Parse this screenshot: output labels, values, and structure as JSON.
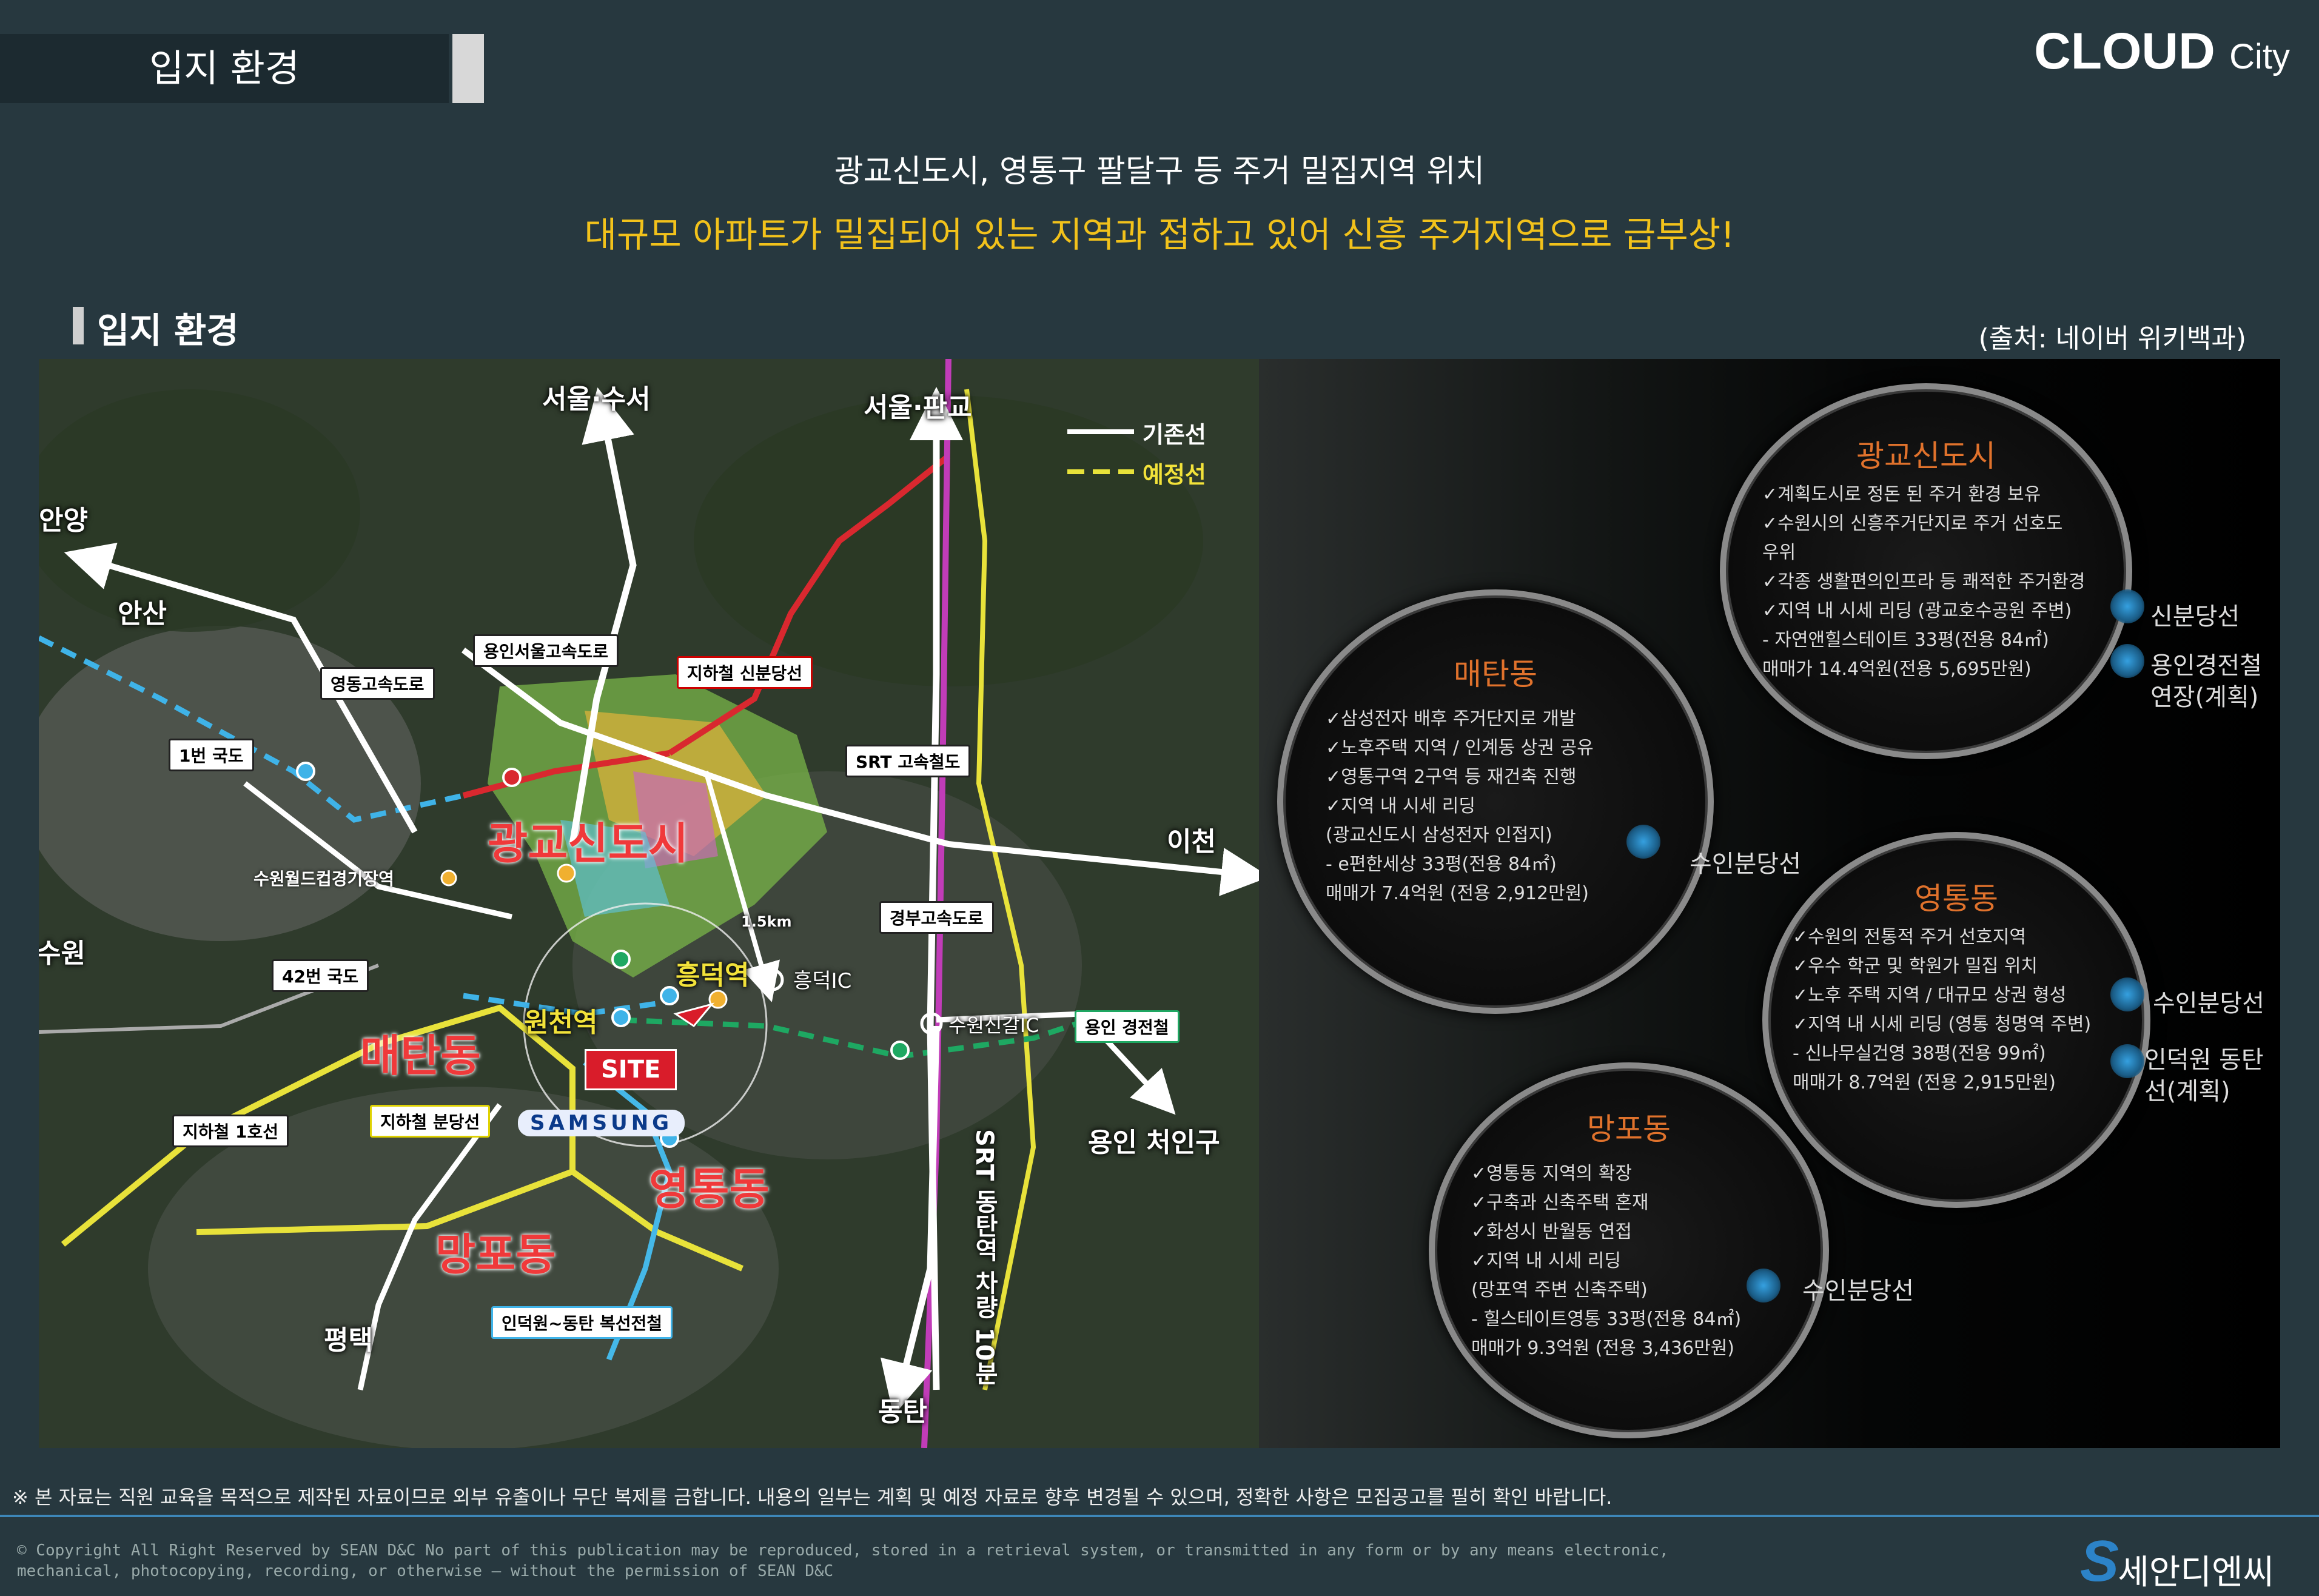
{
  "header": {
    "title": "입지 환경",
    "brand_main": "CLOUD",
    "brand_sub": "City"
  },
  "headline": {
    "line1": "광교신도시, 영통구 팔달구 등 주거 밀집지역 위치",
    "line2": "대규모 아파트가 밀집되어 있는 지역과 접하고 있어 신흥 주거지역으로 급부상!"
  },
  "section": {
    "title": "입지  환경",
    "source": "(출처: 네이버 위키백과)"
  },
  "map": {
    "legend": {
      "existing": "기존선",
      "planned": "예정선"
    },
    "places": {
      "seoul_suseo": "서울·수서",
      "seoul_pangyo": "서울·판교",
      "anyang": "안양",
      "ansan": "안산",
      "suwon": "수원",
      "icheon": "이천",
      "yongin": "용인 처인구",
      "pyeongtaek": "평택",
      "dongtan": "동탄",
      "heungdeok_ic": "흥덕IC",
      "suwon_sin_ic": "수원신갈IC",
      "distance": "1.5km"
    },
    "districts": {
      "gwanggyo": "광교신도시",
      "maetan": "매탄동",
      "yeongtong": "영통동",
      "mangpo": "망포동"
    },
    "stations": {
      "heungdeok": "흥덕역",
      "woncheon": "원천역"
    },
    "boxes": {
      "yongin_seoul_exp": "용인서울고속도로",
      "yeongdong_exp": "영동고속도로",
      "sinbundang": "지하철 신분당선",
      "route1": "1번 국도",
      "srt": "SRT 고속철도",
      "worldcup": "수원월드컵경기장역",
      "gyeongbu": "경부고속도로",
      "route42": "42번 국도",
      "yongin_light": "용인 경전철",
      "bundang_line": "지하철 분당선",
      "line1": "지하철 1호선",
      "indeogwon": "인덕원~동탄 복선전철"
    },
    "site": "SITE",
    "samsung": "SAMSUNG",
    "srt_label": "SRT 동탄역 차량 10분"
  },
  "circles": [
    {
      "title": "광교신도시",
      "items": [
        "✓계획도시로 정돈 된 주거 환경 보유",
        "✓수원시의 신흥주거단지로 주거 선호도",
        "   우위",
        "✓각종 생활편의인프라 등 쾌적한 주거환경",
        "✓지역 내 시세 리딩 (광교호수공원 주변)",
        "  - 자연앤힐스테이트 33평(전용 84㎡)",
        "    매매가 14.4억원(전용 5,695만원)"
      ],
      "tags": [
        "신분당선",
        "용인경전철 연장(계획)"
      ]
    },
    {
      "title": "매탄동",
      "items": [
        "✓삼성전자 배후 주거단지로 개발",
        "✓노후주택 지역 / 인계동 상권 공유",
        "✓영통구역 2구역 등 재건축 진행",
        "✓지역 내 시세 리딩",
        "  (광교신도시 삼성전자 인접지)",
        "  - e편한세상 33평(전용 84㎡)",
        "    매매가 7.4억원 (전용 2,912만원)"
      ],
      "tags": [
        "수인분당선"
      ]
    },
    {
      "title": "영통동",
      "items": [
        "✓수원의 전통적 주거 선호지역",
        "✓우수 학군 및 학원가 밀집 위치",
        "✓노후 주택 지역 / 대규모 상권 형성",
        "✓지역 내 시세 리딩 (영통 청명역 주변)",
        "  - 신나무실건영 38평(전용 99㎡)",
        "    매매가 8.7억원 (전용 2,915만원)"
      ],
      "tags": [
        "수인분당선",
        "인덕원 동탄선(계획)"
      ]
    },
    {
      "title": "망포동",
      "items": [
        "✓영통동 지역의 확장",
        "✓구축과 신축주택 혼재",
        "✓화성시 반월동 연접",
        "✓지역 내 시세 리딩",
        "  (망포역 주변 신축주택)",
        "  - 힐스테이트영통 33평(전용 84㎡)",
        "    매매가 9.3억원 (전용 3,436만원)"
      ],
      "tags": [
        "수인분당선"
      ]
    }
  ],
  "footer": {
    "notice": "※ 본 자료는 직원 교육을 목적으로 제작된 자료이므로 외부 유출이나 무단 복제를 금합니다. 내용의 일부는 계획 및 예정 자료로 향후 변경될 수 있으며, 정확한 사항은 모집공고를 필히 확인 바랍니다.",
    "copyright": "© Copyright All Right Reserved by SEAN D&C  No part of this publication may be reproduced, stored in a retrieval system, or transmitted in any form or by any means electronic, mechanical, photocopying, recording, or otherwise — without the permission of SEAN D&C",
    "logo_text": "세안디엔씨"
  },
  "colors": {
    "background": "#27383f",
    "headline_accent": "#f2c21b",
    "district_red": "#f0393a",
    "circle_title": "#e0722c"
  }
}
